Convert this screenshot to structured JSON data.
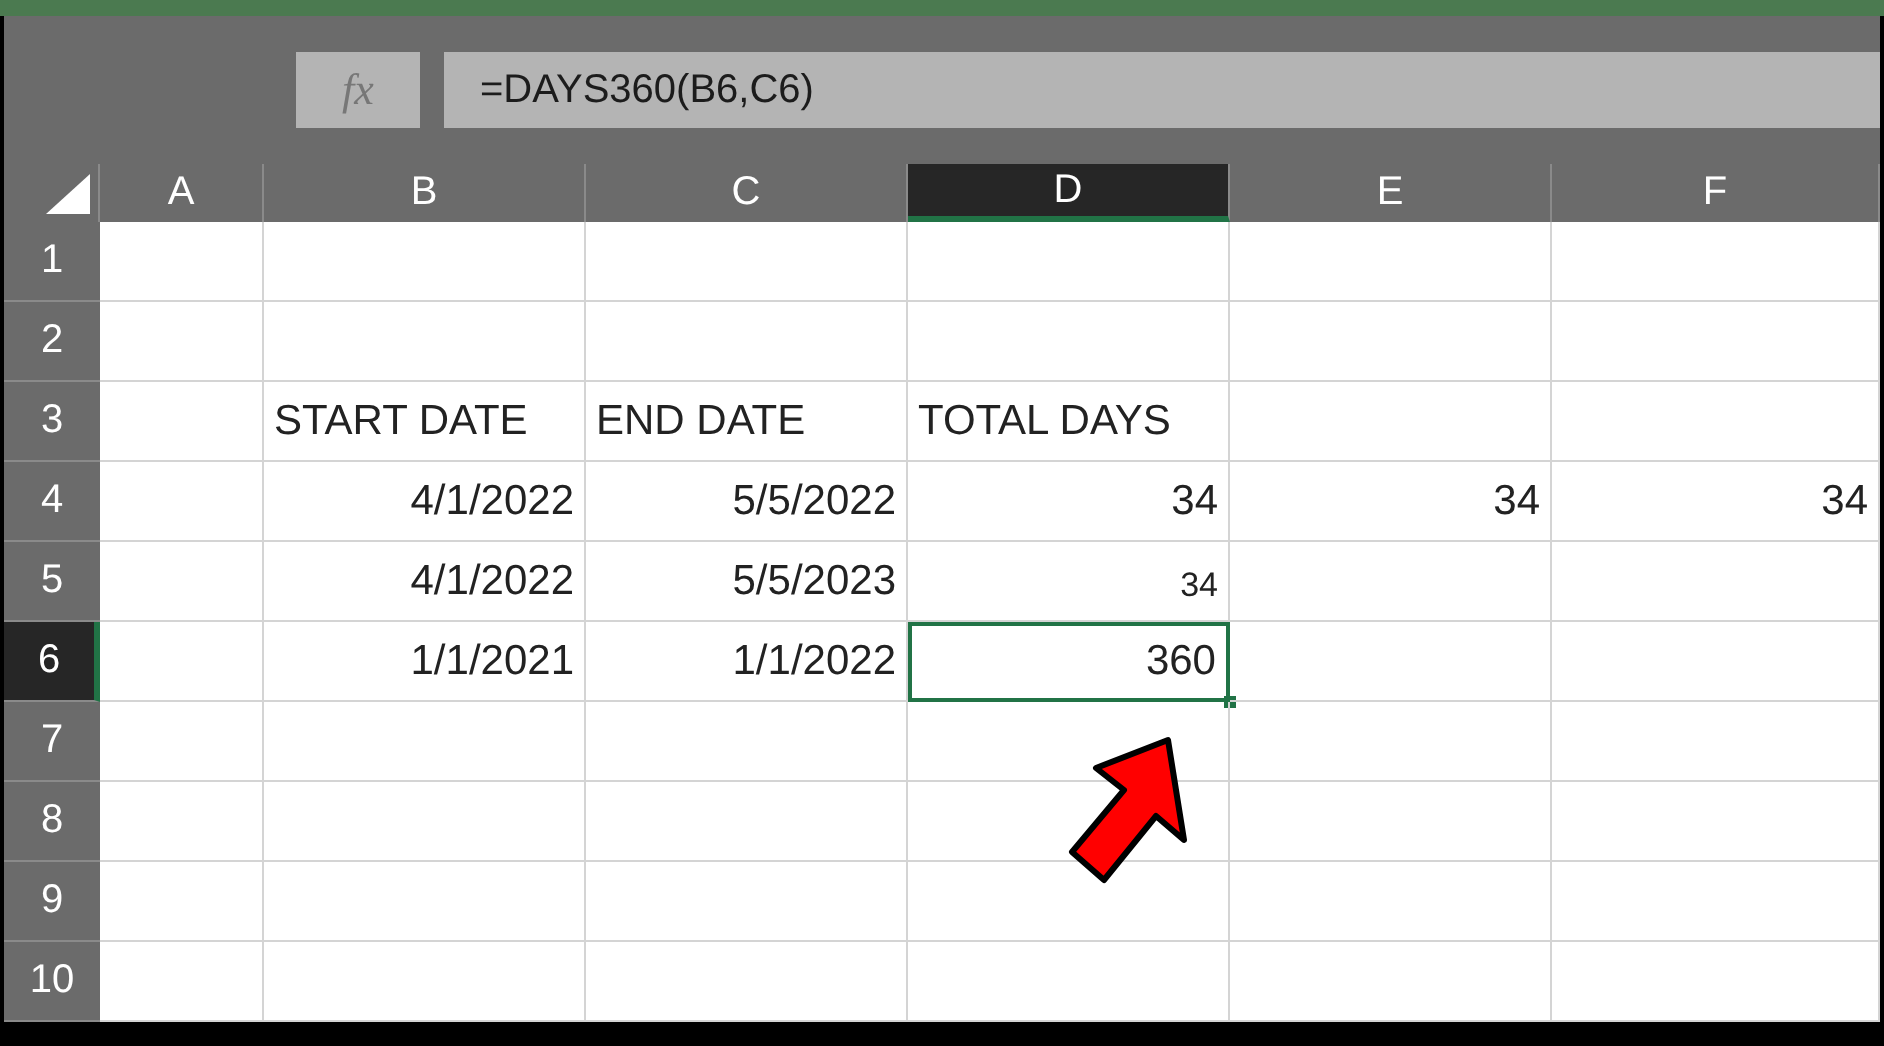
{
  "formula_bar": {
    "fx": "fx",
    "formula": "=DAYS360(B6,C6)"
  },
  "columns": [
    {
      "label": "A",
      "selected": false
    },
    {
      "label": "B",
      "selected": false
    },
    {
      "label": "C",
      "selected": false
    },
    {
      "label": "D",
      "selected": true
    },
    {
      "label": "E",
      "selected": false
    },
    {
      "label": "F",
      "selected": false
    }
  ],
  "rows": [
    {
      "number": "1",
      "selected": false,
      "cells": [
        null,
        null,
        null,
        null,
        null,
        null
      ]
    },
    {
      "number": "2",
      "selected": false,
      "cells": [
        null,
        null,
        null,
        null,
        null,
        null
      ]
    },
    {
      "number": "3",
      "selected": false,
      "cells": [
        null,
        {
          "text": "START DATE",
          "kind": "label",
          "active": false
        },
        {
          "text": "END DATE",
          "kind": "label",
          "active": false
        },
        {
          "text": "TOTAL DAYS",
          "kind": "label",
          "active": false
        },
        null,
        null
      ]
    },
    {
      "number": "4",
      "selected": false,
      "cells": [
        null,
        {
          "text": "4/1/2022",
          "kind": "number",
          "active": false
        },
        {
          "text": "5/5/2022",
          "kind": "number",
          "active": false
        },
        {
          "text": "34",
          "kind": "number",
          "active": false
        },
        {
          "text": "34",
          "kind": "number",
          "active": false
        },
        {
          "text": "34",
          "kind": "number",
          "active": false
        }
      ]
    },
    {
      "number": "5",
      "selected": false,
      "cells": [
        null,
        {
          "text": "4/1/2022",
          "kind": "number",
          "active": false
        },
        {
          "text": "5/5/2023",
          "kind": "number",
          "active": false
        },
        {
          "text": "34",
          "kind": "small",
          "active": false
        },
        null,
        null
      ]
    },
    {
      "number": "6",
      "selected": true,
      "cells": [
        null,
        {
          "text": "1/1/2021",
          "kind": "number",
          "active": false
        },
        {
          "text": "1/1/2022",
          "kind": "number",
          "active": false
        },
        {
          "text": "360",
          "kind": "number",
          "active": true
        },
        null,
        null
      ]
    },
    {
      "number": "7",
      "selected": false,
      "cells": [
        null,
        null,
        null,
        null,
        null,
        null
      ]
    },
    {
      "number": "8",
      "selected": false,
      "cells": [
        null,
        null,
        null,
        null,
        null,
        null
      ]
    },
    {
      "number": "9",
      "selected": false,
      "cells": [
        null,
        null,
        null,
        null,
        null,
        null
      ]
    },
    {
      "number": "10",
      "selected": false,
      "cells": [
        null,
        null,
        null,
        null,
        null,
        null
      ]
    }
  ]
}
